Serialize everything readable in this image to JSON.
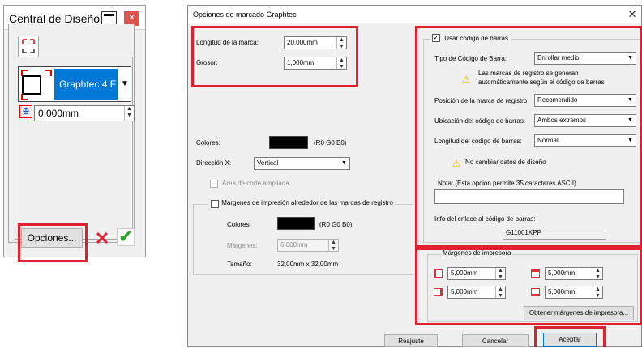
{
  "panel": {
    "title": "Central de Diseño",
    "close_glyph": "×",
    "device": "Graphtec 4 F",
    "offset_value": "0,000mm",
    "opciones_label": "Opciones...",
    "cancel_glyph": "✕",
    "ok_glyph": "✔"
  },
  "dialog": {
    "title": "Opciones de marcado Graphtec",
    "close_glyph": "✕",
    "mark_length_label": "Longitud de la marca:",
    "mark_length_value": "20,000mm",
    "thickness_label": "Grosor:",
    "thickness_value": "1,000mm",
    "colors_label": "Colores:",
    "colors_value": "(R0 G0 B0)",
    "direction_label": "Dirección X:",
    "direction_value": "Vertical",
    "extended_area_label": "Área de corte ampliada",
    "print_margins_label": "Márgenes de impresión alrededor de las marcas de registro",
    "pm_colors_label": "Colores:",
    "pm_colors_value": "(R0 G0 B0)",
    "pm_margins_label": "Márgenes:",
    "pm_margins_value": "6,000mm",
    "pm_size_label": "Tamaño:",
    "pm_size_value": "32,00mm x 32,00mm",
    "barcode": {
      "use_label": "Usar código de barras",
      "type_label": "Tipo de Código de Barra:",
      "type_value": "Enrollar medio",
      "note_line1": "Las marcas de registro se generan",
      "note_line2": "automáticamente según el código de barras",
      "position_label": "Posición de la marca de registro",
      "position_value": "Recomendido",
      "location_label": "Ubicación del código de barras:",
      "location_value": "Ambos extremos",
      "length_label": "Longitud del código de barras:",
      "length_value": "Normal",
      "no_change_label": "No cambiar datos de diseño",
      "note_label": "Nota: (Esta opción permite 35 caracteres ASCII)",
      "note_value": "",
      "link_info_label": "Info del enlace al código de barras:",
      "link_info_value": "G11001KPP"
    },
    "printer_margins": {
      "title": "Márgenes de impresora",
      "left_value": "5,000mm",
      "top_value": "5,000mm",
      "right_value": "5,000mm",
      "bottom_value": "5,000mm",
      "get_button_label": "Obtener márgenes de impresora..."
    },
    "reset_label": "Reajuste",
    "cancel_label": "Cancelar",
    "accept_label": "Aceptar"
  },
  "colors": {
    "accent": "#0078d7",
    "highlight_red": "#e0202e",
    "ok_green": "#2aa52a"
  }
}
